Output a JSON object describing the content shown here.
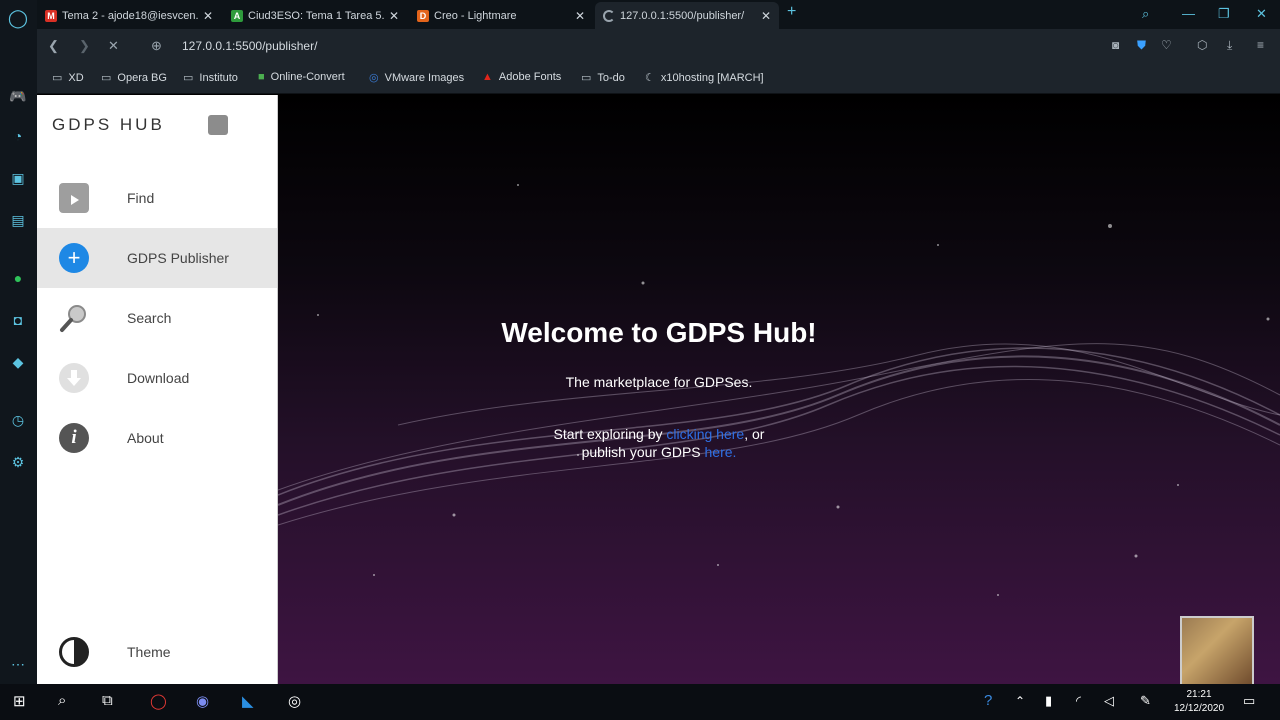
{
  "browser": {
    "tabs": [
      {
        "title": "Tema 2 - ajode18@iesvcen...",
        "favicon": "gmail-icon",
        "active": false
      },
      {
        "title": "Ciud3ESO: Tema 1 Tarea 5...",
        "favicon": "moodle-icon",
        "active": false
      },
      {
        "title": "Creo - Lightmare",
        "favicon": "creo-icon",
        "active": false
      },
      {
        "title": "127.0.0.1:5500/publisher/",
        "favicon": "loading-icon",
        "active": true
      }
    ],
    "url": "127.0.0.1:5500/publisher/",
    "bookmarks": [
      {
        "label": "XD",
        "icon": "folder-icon"
      },
      {
        "label": "Opera BG",
        "icon": "folder-icon"
      },
      {
        "label": "Instituto",
        "icon": "folder-icon"
      },
      {
        "label": "Online-Convert",
        "icon": "online-convert-icon"
      },
      {
        "label": "VMware Images",
        "icon": "vmware-icon"
      },
      {
        "label": "Adobe Fonts",
        "icon": "adobe-icon"
      },
      {
        "label": "To-do",
        "icon": "folder-icon"
      },
      {
        "label": "x10hosting [MARCH]",
        "icon": "x10-icon"
      }
    ]
  },
  "sidebar": {
    "brand": "GDPS HUB",
    "items": [
      {
        "label": "Find",
        "icon": "play-store-icon",
        "active": false
      },
      {
        "label": "GDPS Publisher",
        "icon": "plus-icon",
        "active": true
      },
      {
        "label": "Search",
        "icon": "magnifier-icon",
        "active": false
      },
      {
        "label": "Download",
        "icon": "download-icon",
        "active": false
      },
      {
        "label": "About",
        "icon": "info-icon",
        "active": false
      }
    ],
    "theme_label": "Theme"
  },
  "main": {
    "title": "Welcome to GDPS Hub!",
    "tagline": "The marketplace for GDPSes.",
    "explore_prefix": "Start exploring by ",
    "explore_link": "clicking here",
    "explore_mid": ", or publish your GDPS ",
    "publish_link": "here."
  },
  "taskbar": {
    "time": "21:21",
    "date": "12/12/2020"
  },
  "colors": {
    "accent": "#1e88e5",
    "link": "#2f6fe4"
  }
}
